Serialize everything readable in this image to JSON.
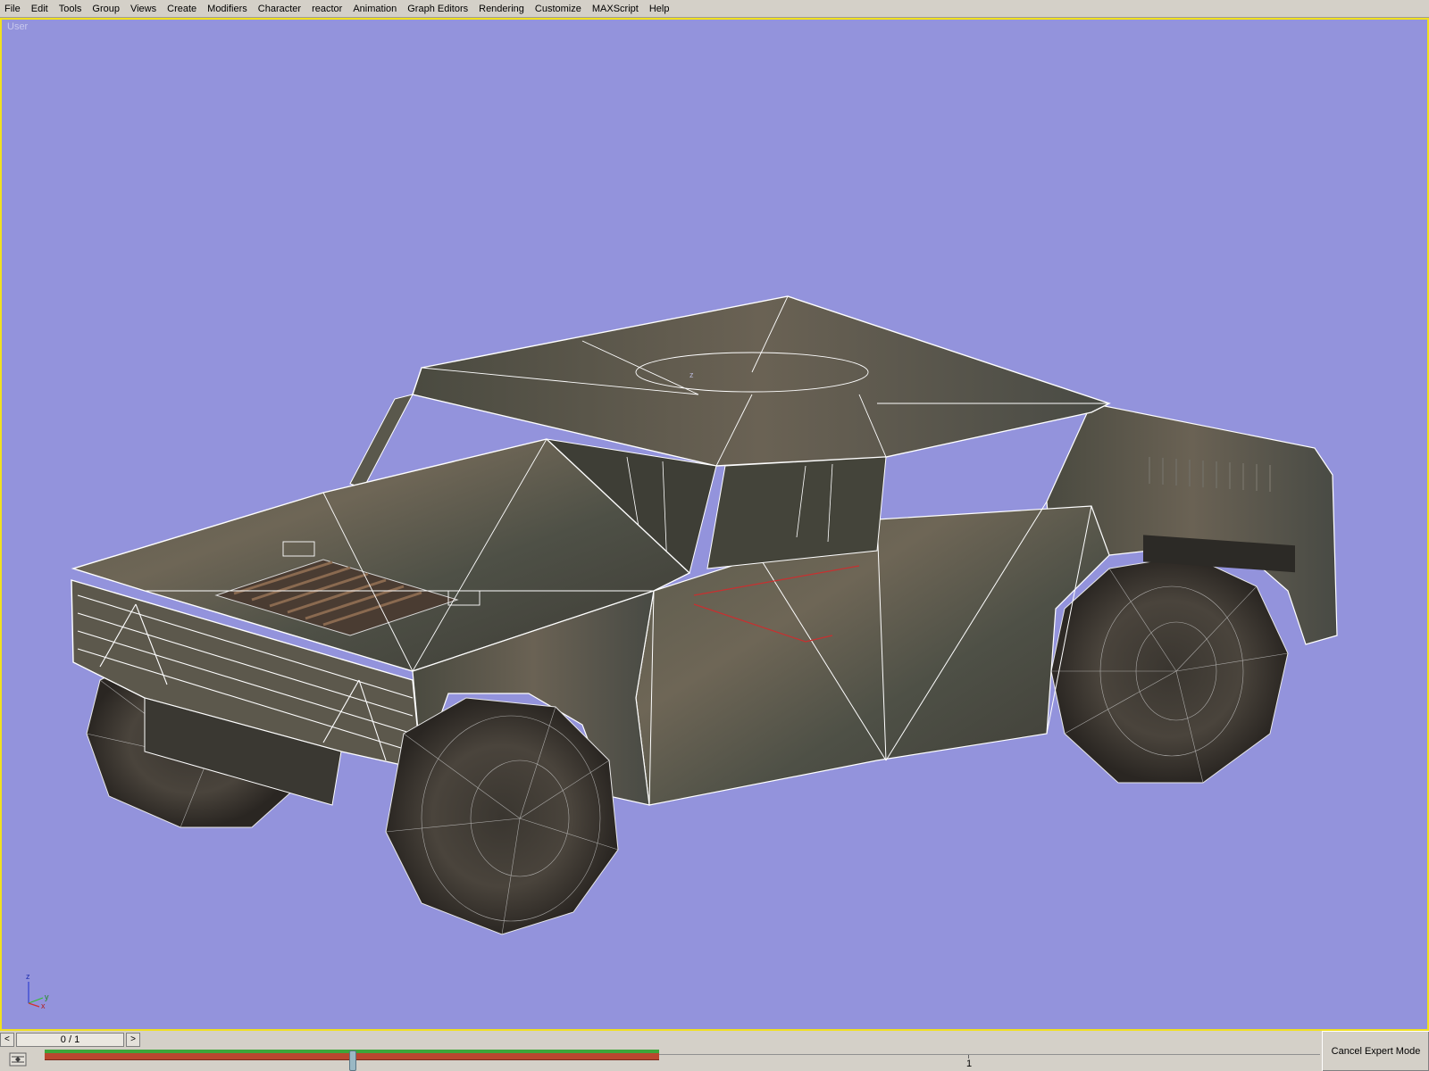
{
  "menu": {
    "items": [
      "File",
      "Edit",
      "Tools",
      "Group",
      "Views",
      "Create",
      "Modifiers",
      "Character",
      "reactor",
      "Animation",
      "Graph Editors",
      "Rendering",
      "Customize",
      "MAXScript",
      "Help"
    ]
  },
  "viewport": {
    "label": "User",
    "background_color": "#9393dc",
    "active_border_color": "#f0e020",
    "model_pivot_axis_label": "z"
  },
  "axis_gizmo": {
    "z": "z",
    "x": "x",
    "y": "y"
  },
  "time_slider": {
    "prev_label": "<",
    "readout": "0 / 1",
    "next_label": ">"
  },
  "trackbar": {
    "current_frame": 0,
    "end_frame": 1,
    "tick_label": "1"
  },
  "status": {
    "expert_button_label": "Cancel Expert Mode"
  }
}
